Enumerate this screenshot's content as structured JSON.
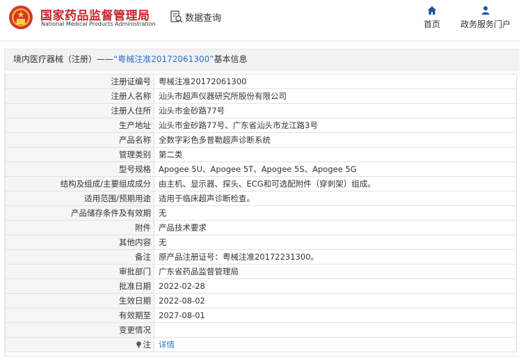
{
  "header": {
    "brand_cn": "国家药品监督管理局",
    "brand_en": "National Medical Products Administration",
    "query_label": "数据查询",
    "nav": {
      "home": "首页",
      "service": "政务服务门户"
    },
    "colors": {
      "brand": "#c3272b",
      "accent": "#2e72c8"
    }
  },
  "panel": {
    "title_prefix": "境内医疗器械（注册）——",
    "title_highlight": "“粤械注准20172061300”",
    "title_suffix": "基本信息"
  },
  "rows": [
    {
      "label": "注册证编号",
      "value": "粤械注准20172061300"
    },
    {
      "label": "注册人名称",
      "value": "汕头市超声仪器研究所股份有限公司"
    },
    {
      "label": "注册人住所",
      "value": "汕头市金砂路77号"
    },
    {
      "label": "生产地址",
      "value": "汕头市金砂路77号、广东省汕头市龙江路3号"
    },
    {
      "label": "产品名称",
      "value": "全数字彩色多普勒超声诊断系统"
    },
    {
      "label": "管理类别",
      "value": "第二类"
    },
    {
      "label": "型号规格",
      "value": "Apogee 5U、Apogee 5T、Apogee 5S、Apogee 5G"
    },
    {
      "label": "结构及组成/主要组成成分",
      "value": "由主机、显示器、探头、ECG和可选配附件（穿刺架）组成。"
    },
    {
      "label": "适用范围/预期用途",
      "value": "适用于临床超声诊断检查。"
    },
    {
      "label": "产品储存条件及有效期",
      "value": "无"
    },
    {
      "label": "附件",
      "value": "产品技术要求"
    },
    {
      "label": "其他内容",
      "value": "无"
    },
    {
      "label": "备注",
      "value": "原产品注册证号：粤械注准20172231300。"
    },
    {
      "label": "审批部门",
      "value": "广东省药品监督管理局"
    },
    {
      "label": "批准日期",
      "value": "2022-02-28"
    },
    {
      "label": "生效日期",
      "value": "2022-08-02"
    },
    {
      "label": "有效期至",
      "value": "2027-08-01"
    },
    {
      "label": "变更情况",
      "value": ""
    }
  ],
  "note_row": {
    "label": "注",
    "link": "详情",
    "icon": "lightbulb-icon"
  }
}
